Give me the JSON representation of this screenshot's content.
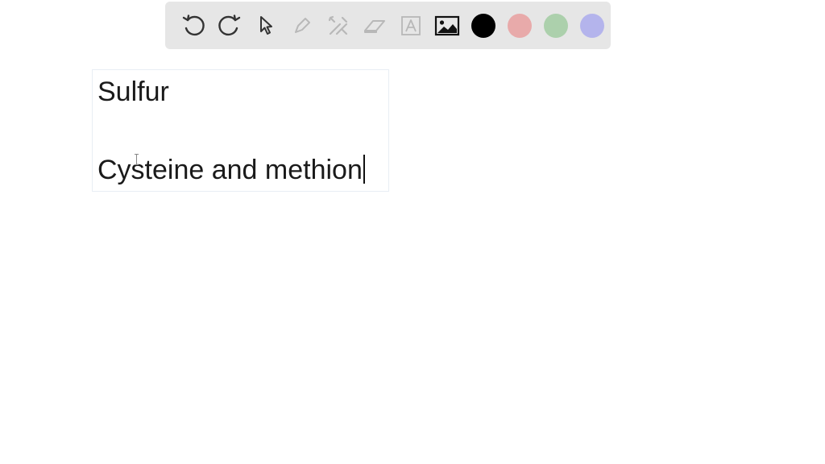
{
  "toolbar": {
    "tools": [
      {
        "name": "undo-icon",
        "enabled": true
      },
      {
        "name": "redo-icon",
        "enabled": true
      },
      {
        "name": "pointer-icon",
        "enabled": true
      },
      {
        "name": "pen-icon",
        "enabled": false
      },
      {
        "name": "tools-icon",
        "enabled": false
      },
      {
        "name": "eraser-icon",
        "enabled": false
      },
      {
        "name": "text-tool-icon",
        "enabled": false
      },
      {
        "name": "image-icon",
        "enabled": true
      }
    ],
    "colors": [
      "#000000",
      "#e8aaaa",
      "#acd0ac",
      "#b4b4ec"
    ],
    "selected_color": "#000000"
  },
  "text_box": {
    "line1": "Sulfur",
    "line2": "Cysteine and methion"
  }
}
